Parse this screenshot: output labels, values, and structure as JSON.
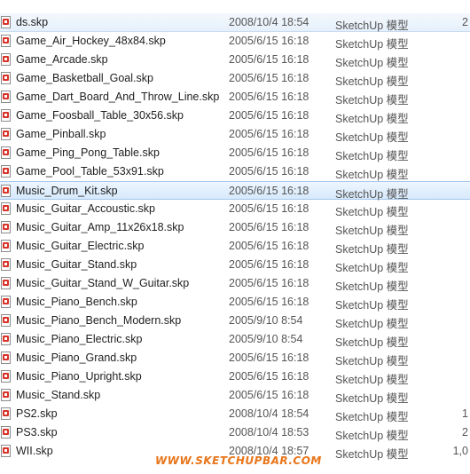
{
  "rows": [
    {
      "name": "ds.skp",
      "date": "2008/10/4 18:54",
      "type": "SketchUp 模型",
      "size": "2",
      "state": "first"
    },
    {
      "name": "Game_Air_Hockey_48x84.skp",
      "date": "2005/6/15 16:18",
      "type": "SketchUp 模型",
      "size": ""
    },
    {
      "name": "Game_Arcade.skp",
      "date": "2005/6/15 16:18",
      "type": "SketchUp 模型",
      "size": ""
    },
    {
      "name": "Game_Basketball_Goal.skp",
      "date": "2005/6/15 16:18",
      "type": "SketchUp 模型",
      "size": ""
    },
    {
      "name": "Game_Dart_Board_And_Throw_Line.skp",
      "date": "2005/6/15 16:18",
      "type": "SketchUp 模型",
      "size": ""
    },
    {
      "name": "Game_Foosball_Table_30x56.skp",
      "date": "2005/6/15 16:18",
      "type": "SketchUp 模型",
      "size": ""
    },
    {
      "name": "Game_Pinball.skp",
      "date": "2005/6/15 16:18",
      "type": "SketchUp 模型",
      "size": ""
    },
    {
      "name": "Game_Ping_Pong_Table.skp",
      "date": "2005/6/15 16:18",
      "type": "SketchUp 模型",
      "size": ""
    },
    {
      "name": "Game_Pool_Table_53x91.skp",
      "date": "2005/6/15 16:18",
      "type": "SketchUp 模型",
      "size": ""
    },
    {
      "name": "Music_Drum_Kit.skp",
      "date": "2005/6/15 16:18",
      "type": "SketchUp 模型",
      "size": "",
      "state": "selected"
    },
    {
      "name": "Music_Guitar_Accoustic.skp",
      "date": "2005/6/15 16:18",
      "type": "SketchUp 模型",
      "size": ""
    },
    {
      "name": "Music_Guitar_Amp_11x26x18.skp",
      "date": "2005/6/15 16:18",
      "type": "SketchUp 模型",
      "size": ""
    },
    {
      "name": "Music_Guitar_Electric.skp",
      "date": "2005/6/15 16:18",
      "type": "SketchUp 模型",
      "size": ""
    },
    {
      "name": "Music_Guitar_Stand.skp",
      "date": "2005/6/15 16:18",
      "type": "SketchUp 模型",
      "size": ""
    },
    {
      "name": "Music_Guitar_Stand_W_Guitar.skp",
      "date": "2005/6/15 16:18",
      "type": "SketchUp 模型",
      "size": ""
    },
    {
      "name": "Music_Piano_Bench.skp",
      "date": "2005/6/15 16:18",
      "type": "SketchUp 模型",
      "size": ""
    },
    {
      "name": "Music_Piano_Bench_Modern.skp",
      "date": "2005/9/10 8:54",
      "type": "SketchUp 模型",
      "size": ""
    },
    {
      "name": "Music_Piano_Electric.skp",
      "date": "2005/9/10 8:54",
      "type": "SketchUp 模型",
      "size": ""
    },
    {
      "name": "Music_Piano_Grand.skp",
      "date": "2005/6/15 16:18",
      "type": "SketchUp 模型",
      "size": ""
    },
    {
      "name": "Music_Piano_Upright.skp",
      "date": "2005/6/15 16:18",
      "type": "SketchUp 模型",
      "size": ""
    },
    {
      "name": "Music_Stand.skp",
      "date": "2005/6/15 16:18",
      "type": "SketchUp 模型",
      "size": ""
    },
    {
      "name": "PS2.skp",
      "date": "2008/10/4 18:54",
      "type": "SketchUp 模型",
      "size": "1"
    },
    {
      "name": "PS3.skp",
      "date": "2008/10/4 18:53",
      "type": "SketchUp 模型",
      "size": "2"
    },
    {
      "name": "WII.skp",
      "date": "2008/10/4 18:57",
      "type": "SketchUp 模型",
      "size": "1,0"
    }
  ],
  "watermark": "WWW.SKETCHUPBAR.COM",
  "icon": "sketchup-file-icon",
  "colors": {
    "selected": "#d6e9fb",
    "watermark": "#e8751a"
  }
}
